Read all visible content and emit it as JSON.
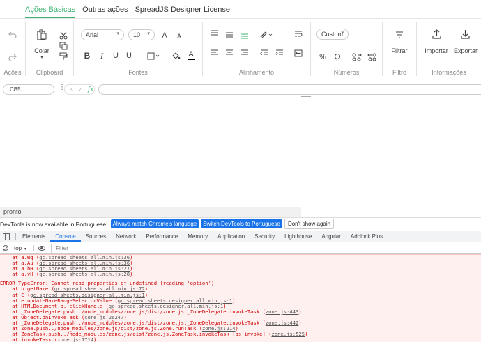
{
  "ribbon": {
    "tabs": [
      "Ações Básicas",
      "Outras ações",
      "SpreadJS Designer License"
    ],
    "groups": {
      "acoes": "Ações",
      "clipboard": "Clipboard",
      "fontes": "Fontes",
      "alinhamento": "Alinhamento",
      "numeros": "Números",
      "filtro": "Filtro",
      "informacoes": "Informações"
    },
    "paste_label": "Colar",
    "font_family": "Arial",
    "font_size": "10",
    "number_format": "Custom",
    "filter_label": "Filtrar",
    "import_label": "Importar",
    "export_label": "Exportar",
    "font_color": "#000000",
    "accent_color": "#3cb371"
  },
  "formula_bar": {
    "name_box": "CB5",
    "controls": "× ✓",
    "fx": "fx",
    "value": ""
  },
  "status": {
    "text": "pronto"
  },
  "devtools": {
    "notification": {
      "message": "DevTools is now available in Portuguese!",
      "match_button": "Always match Chrome's language",
      "switch_button": "Switch DevTools to Portuguese",
      "dismiss_button": "Don't show again"
    },
    "tabs": [
      "Elements",
      "Console",
      "Sources",
      "Network",
      "Performance",
      "Memory",
      "Application",
      "Security",
      "Lighthouse",
      "Angular",
      "Adblock Plus"
    ],
    "active_tab": "Console",
    "context": "top",
    "filter_placeholder": "Filter",
    "console_lines_1": [
      {
        "pre": "    at a.Wq (",
        "link": "gc.spread.sheets.all.min.js:36",
        "post": ")"
      },
      {
        "pre": "    at a.Au (",
        "link": "gc.spread.sheets.all.min.js:36",
        "post": ")"
      },
      {
        "pre": "    at a.hH (",
        "link": "gc.spread.sheets.all.min.js:27",
        "post": ")"
      },
      {
        "pre": "    at a.vH (",
        "link": "gc.spread.sheets.all.min.js:28",
        "post": ")"
      }
    ],
    "console_error": "ERROR TypeError: Cannot read properties of undefined (reading 'option')",
    "console_lines_2": [
      {
        "pre": "    at b.getName (",
        "link": "gc.spread.sheets.all.min.js:72",
        "post": ")"
      },
      {
        "pre": "    at C (",
        "link": "gc.spread.sheets.designer.all.min.js:1",
        "post": ")"
      },
      {
        "pre": "    at e.updateNameRangeSelectorValue (",
        "link": "gc.spread.sheets.designer.all.min.js:1",
        "post": ")"
      },
      {
        "pre": "    at HTMLDocument.b._clickHandle (",
        "link": "gc.spread.sheets.designer.all.min.js:1",
        "post": ")"
      },
      {
        "pre": "    at _ZoneDelegate.push../node_modules/zone.js/dist/zone.js._ZoneDelegate.invokeTask (",
        "link": "zone.js:443",
        "post": ")"
      },
      {
        "pre": "    at Object.onInvokeTask (",
        "link": "core.js:26247",
        "post": ")"
      },
      {
        "pre": "    at _ZoneDelegate.push../node_modules/zone.js/dist/zone.js._ZoneDelegate.invokeTask (",
        "link": "zone.js:442",
        "post": ")"
      },
      {
        "pre": "    at Zone.push../node_modules/zone.js/dist/zone.js.Zone.runTask (",
        "link": "zone.js:214",
        "post": ")"
      },
      {
        "pre": "    at ZoneTask.push../node_modules/zone.js/dist/zone.js.ZoneTask.invokeTask [as invoke] (",
        "link": "zone.js:525",
        "post": ")"
      },
      {
        "pre": "    at invokeTask (",
        "link": "zone.js:1714",
        "post": ")"
      }
    ]
  }
}
